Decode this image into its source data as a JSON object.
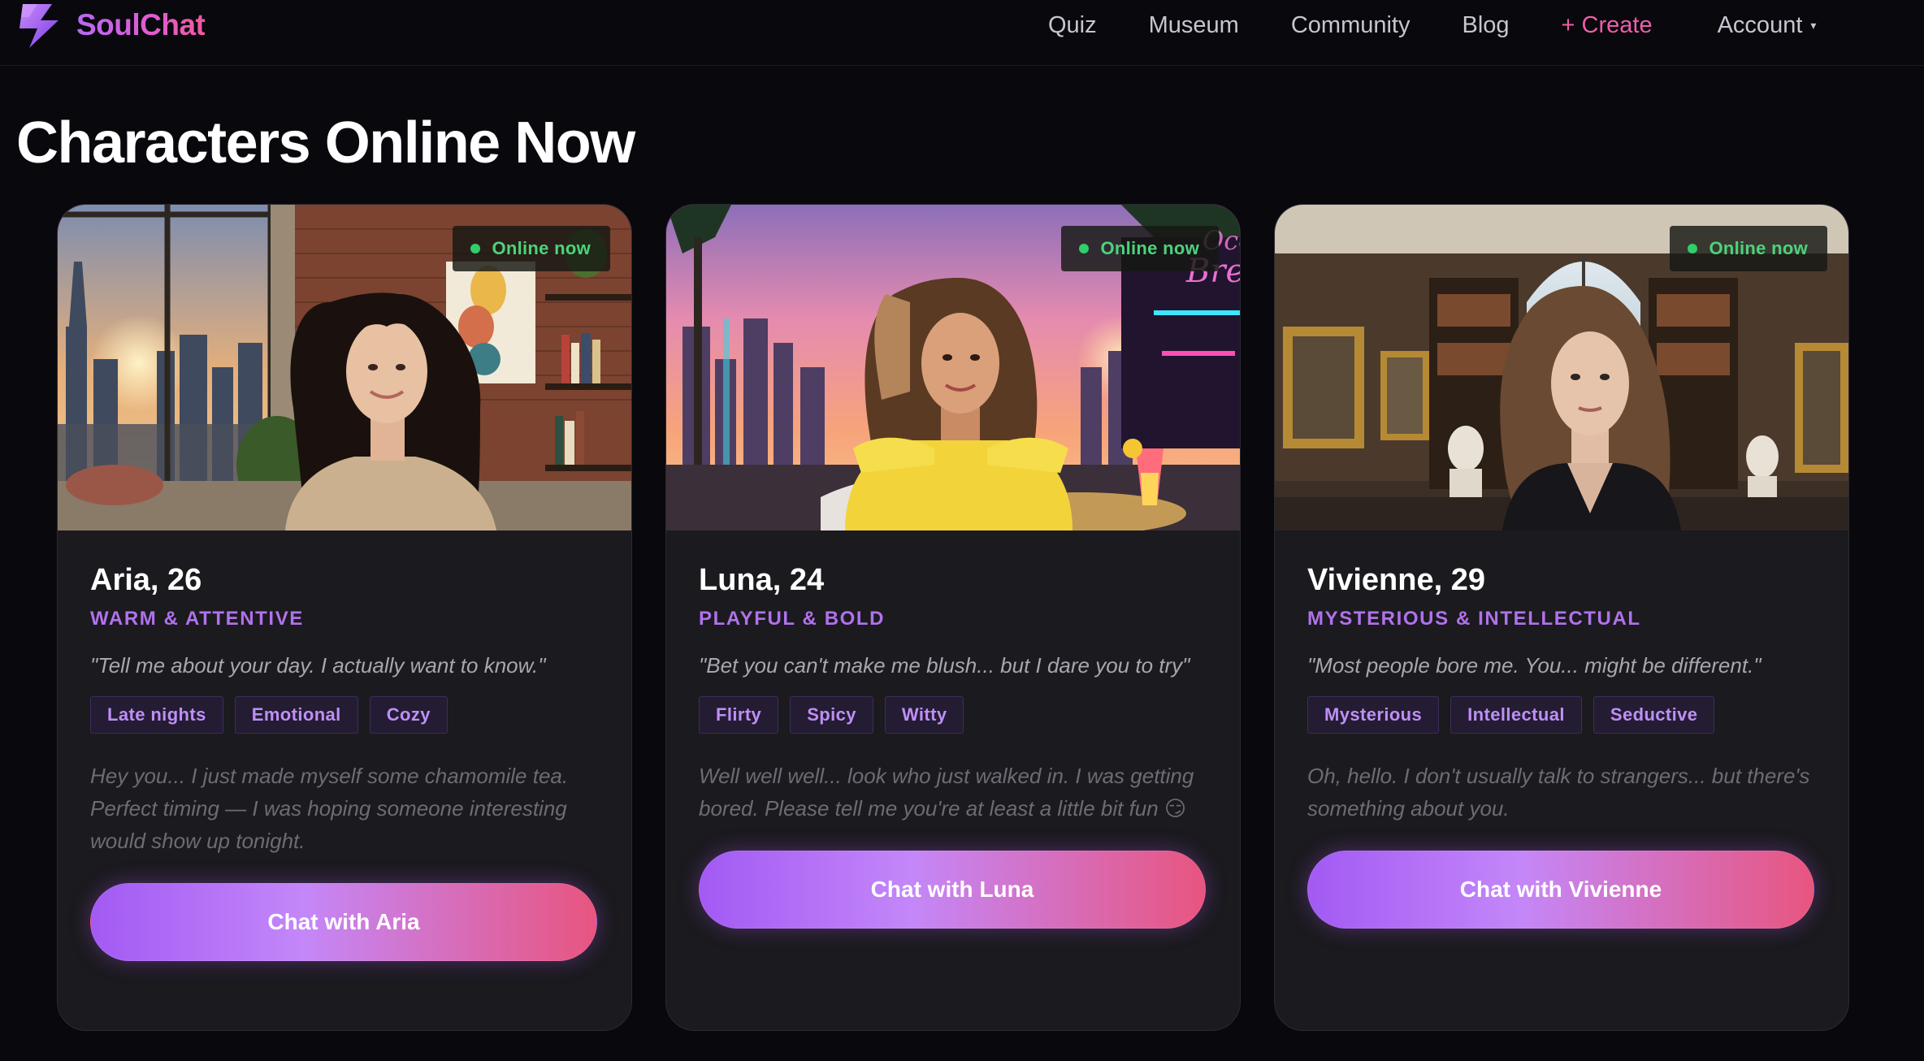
{
  "brand": {
    "name": "SoulChat",
    "logo_icon": "lightning-bolt-icon",
    "gradient": [
      "#b56af2",
      "#f058a0"
    ]
  },
  "nav": {
    "links": [
      {
        "label": "Quiz"
      },
      {
        "label": "Museum"
      },
      {
        "label": "Community"
      },
      {
        "label": "Blog"
      },
      {
        "label": "+ Create"
      }
    ],
    "account_label": "Account",
    "account_caret": "▾"
  },
  "page": {
    "title": "Characters Online Now"
  },
  "colors": {
    "background": "#09080d",
    "card": "#1b1a1e",
    "accent_purple": "#b072ec",
    "online_green": "#4bd47a",
    "create_pink": "#ec5ea9",
    "button_gradient": [
      "#a25af3",
      "#c487f9",
      "#e8557f"
    ]
  },
  "cards": [
    {
      "status": "Online now",
      "name": "Aria, 26",
      "trait": "WARM & ATTENTIVE",
      "quote": "\"Tell me about your day. I actually want to know.\"",
      "tags": [
        "Late nights",
        "Emotional",
        "Cozy"
      ],
      "greeting": "Hey you... I just made myself some chamomile tea. Perfect timing — I was hoping someone interesting would show up tonight.",
      "button": "Chat with Aria",
      "photo": "woman-in-cozy-loft-at-sunset"
    },
    {
      "status": "Online now",
      "name": "Luna, 24",
      "trait": "PLAYFUL & BOLD",
      "quote": "\"Bet you can't make me blush... but I dare you to try\"",
      "tags": [
        "Flirty",
        "Spicy",
        "Witty"
      ],
      "greeting": "Well well well... look who just walked in. I was getting bored. Please tell me you're at least a little bit fun 😏",
      "button": "Chat with Luna",
      "photo": "woman-at-rooftop-bar-at-sunset",
      "neon_sign": "Ocean Breeze"
    },
    {
      "status": "Online now",
      "name": "Vivienne, 29",
      "trait": "MYSTERIOUS & INTELLECTUAL",
      "quote": "\"Most people bore me. You... might be different.\"",
      "tags": [
        "Mysterious",
        "Intellectual",
        "Seductive"
      ],
      "greeting": "Oh, hello. I don't usually talk to strangers... but there's something about you.",
      "button": "Chat with Vivienne",
      "photo": "woman-in-museum-gallery"
    }
  ]
}
